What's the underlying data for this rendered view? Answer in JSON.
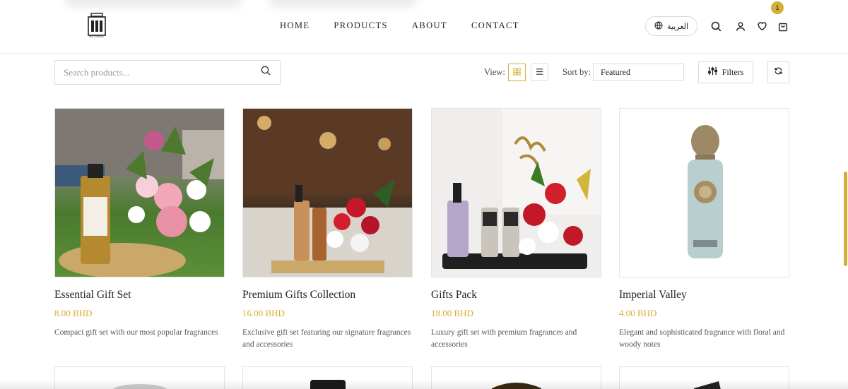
{
  "header": {
    "brand": "ALHERZ",
    "nav": [
      "HOME",
      "PRODUCTS",
      "ABOUT",
      "CONTACT"
    ],
    "language_label": "العربية",
    "cart_count": "1"
  },
  "toolbar": {
    "search_placeholder": "Search products...",
    "view_label": "View:",
    "sort_label": "Sort by:",
    "sort_value": "Featured",
    "filters_label": "Filters"
  },
  "products": [
    {
      "title": "Essential Gift Set",
      "price": "8.00 BHD",
      "description": "Compact gift set with our most popular fragrances"
    },
    {
      "title": "Premium Gifts Collection",
      "price": "16.00 BHD",
      "description": "Exclusive gift set featuring our signature fragrances and accessories"
    },
    {
      "title": "Gifts Pack",
      "price": "18.00 BHD",
      "description": "Luxury gift set with premium fragrances and accessories"
    },
    {
      "title": "Imperial Valley",
      "price": "4.00 BHD",
      "description": "Elegant and sophisticated fragrance with floral and woody notes"
    }
  ],
  "colors": {
    "accent": "#d4af37",
    "border": "#dcdcdc",
    "text": "#222222"
  }
}
